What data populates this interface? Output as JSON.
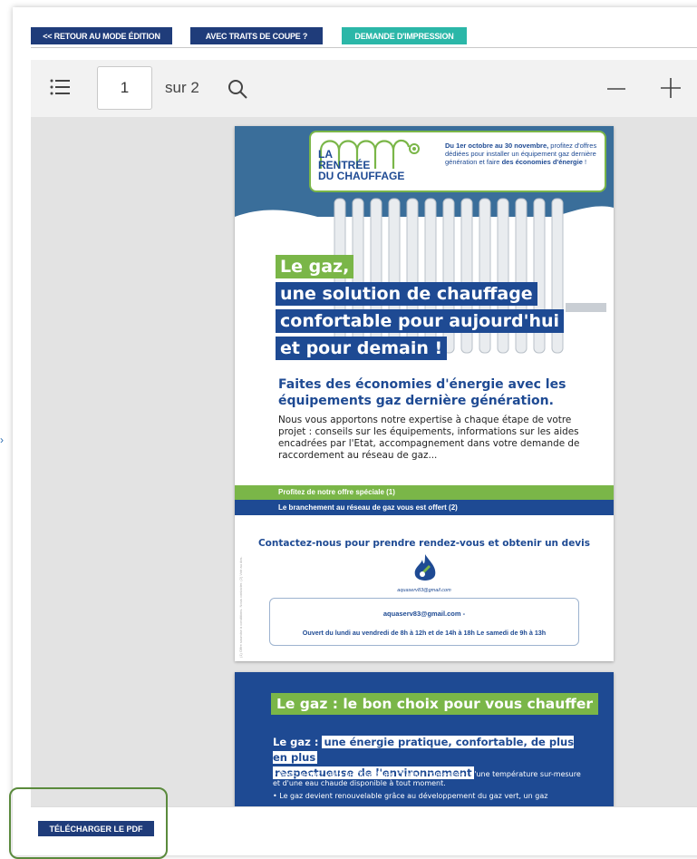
{
  "toolbar_top": {
    "back_label": "<< RETOUR AU MODE ÉDITION",
    "crop_label": "AVEC TRAITS DE COUPE ?",
    "print_label": "DEMANDE D'IMPRESSION"
  },
  "viewer": {
    "page_value": "1",
    "page_of": "sur 2",
    "icons": [
      "list-icon",
      "search-icon",
      "zoom-out-icon",
      "zoom-in-icon"
    ]
  },
  "page1": {
    "logo_line1": "LA",
    "logo_line2": "RENTRÉE",
    "logo_line3": "DU CHAUFFAGE",
    "promo_bold": "Du 1er octobre au 30 novembre,",
    "promo_text": "profitez d'offres dédiées pour installer un équipement gaz dernière génération et faire",
    "promo_emph": "des économies d'énergie",
    "promo_end": " !",
    "headline_1": "Le gaz,",
    "headline_2": "une solution de chauffage",
    "headline_3": "confortable pour aujourd'hui",
    "headline_4": "et pour demain !",
    "subtitle": "Faites des économies d'énergie avec les équipements gaz dernière génération.",
    "body": "Nous vous apportons notre expertise à  chaque étape de  votre projet : conseils sur les équipements, informations sur les aides encadrées par l'Etat, accompagnement dans votre demande de raccordement au réseau de gaz...",
    "band_green": "Profitez de notre offre spéciale (1)",
    "band_blue": "Le branchement au réseau de gaz vous est offert (2)",
    "contact_title": "Contactez-nous pour prendre rendez-vous et obtenir un devis",
    "contact_email_small": "aquaserv83@gmail.com",
    "contact_email": "aquaserv83@gmail.com -",
    "contact_hours": "Ouvert du lundi au vendredi de 8h à 12h et de 14h à 18h Le samedi de 9h à 13h",
    "side_note": "(1) Offre soumise à conditions. Nous contacter. (2) Voir au dos."
  },
  "page2": {
    "title": "Le gaz : le bon choix pour vous chauffer",
    "lead_prefix": "Le gaz :",
    "lead_highlight_1": "une énergie pratique, confortable, de plus en plus",
    "lead_highlight_2": "respectueuse de l'environnement",
    "bullet_1": "• Avec le gaz, vous profitez d'une chaleur homogène, d'une température sur-mesure et d'une eau chaude disponible à tout moment.",
    "bullet_2": "• Le gaz devient renouvelable grâce au développement du gaz vert, un gaz"
  },
  "bottom": {
    "download_label": "TÉLÉCHARGER LE PDF"
  },
  "colors": {
    "navy": "#1f3c7a",
    "teal": "#2bb7a8",
    "green": "#7ab648",
    "blue": "#1e4a93"
  }
}
